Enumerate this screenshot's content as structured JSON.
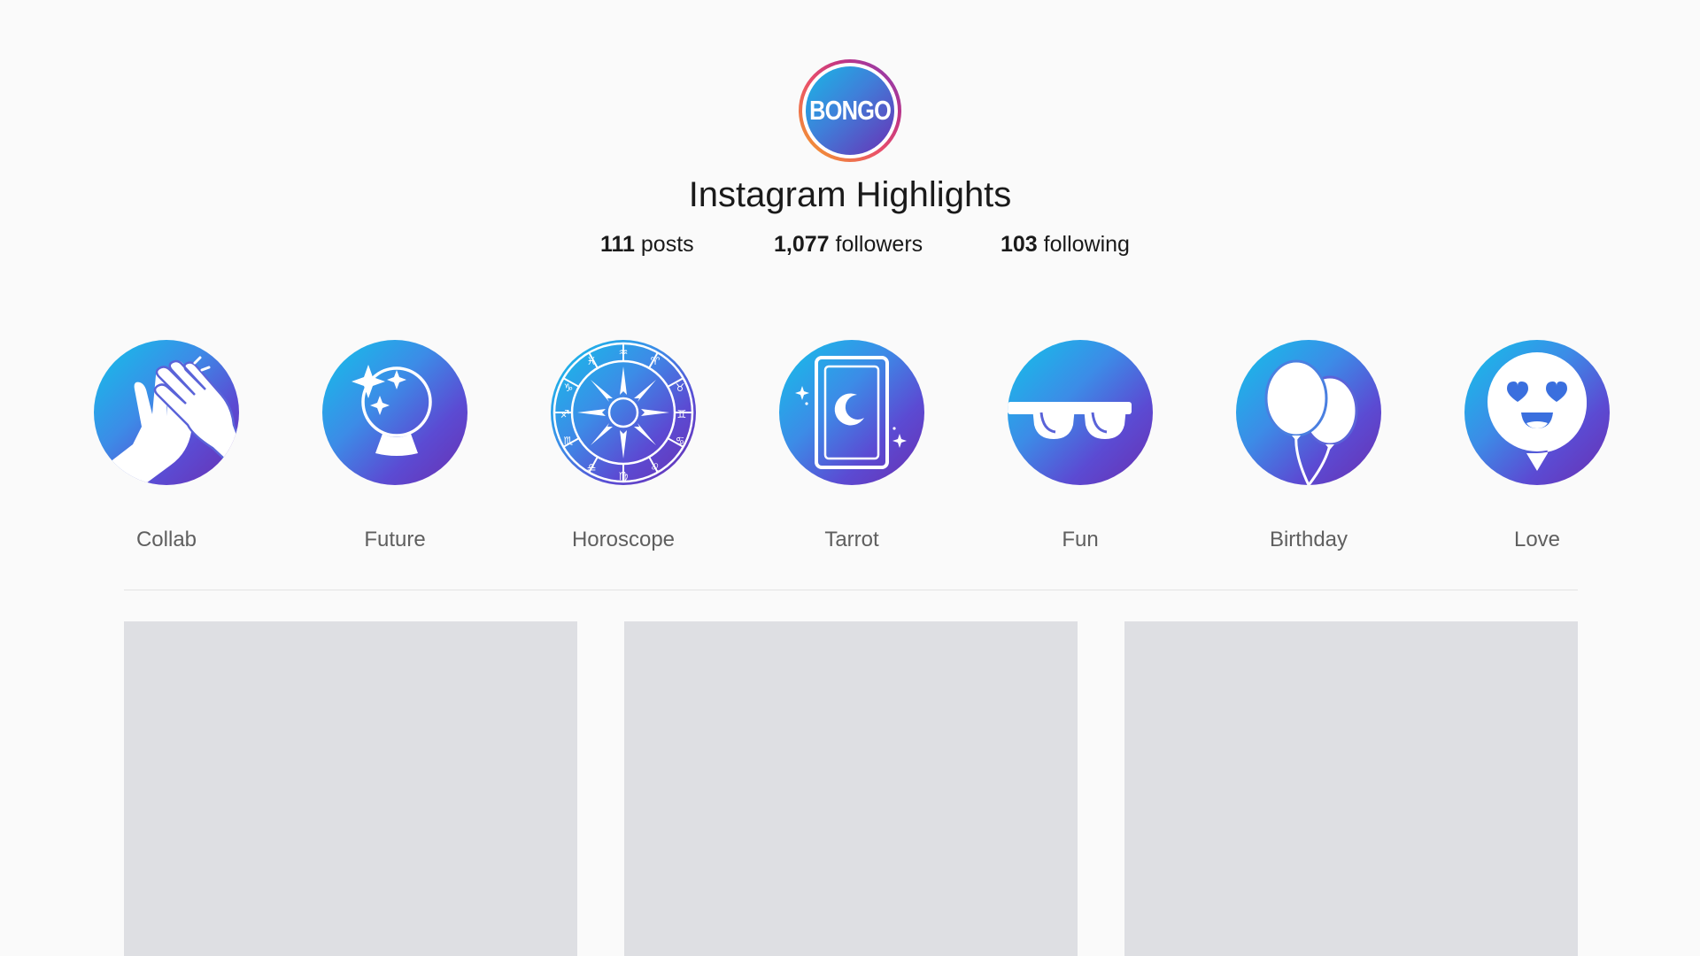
{
  "profile": {
    "avatar_text": "BONGO",
    "title": "Instagram Highlights",
    "stats": {
      "posts_count": "111",
      "posts_label": "posts",
      "followers_count": "1,077",
      "followers_label": "followers",
      "following_count": "103",
      "following_label": "following"
    }
  },
  "highlights": [
    {
      "label": "Collab",
      "icon": "clapping-hands-icon"
    },
    {
      "label": "Future",
      "icon": "crystal-ball-icon"
    },
    {
      "label": "Horoscope",
      "icon": "zodiac-wheel-icon"
    },
    {
      "label": "Tarrot",
      "icon": "tarot-card-icon"
    },
    {
      "label": "Fun",
      "icon": "sunglasses-icon"
    },
    {
      "label": "Birthday",
      "icon": "balloons-icon"
    },
    {
      "label": "Love",
      "icon": "heart-eyes-emoji-icon"
    }
  ],
  "posts_grid": {
    "tile_count": 3
  },
  "colors": {
    "background": "#fafafa",
    "gradient_start": "#12c2e9",
    "gradient_end": "#6a2fb0",
    "tile": "#dedfe3"
  }
}
